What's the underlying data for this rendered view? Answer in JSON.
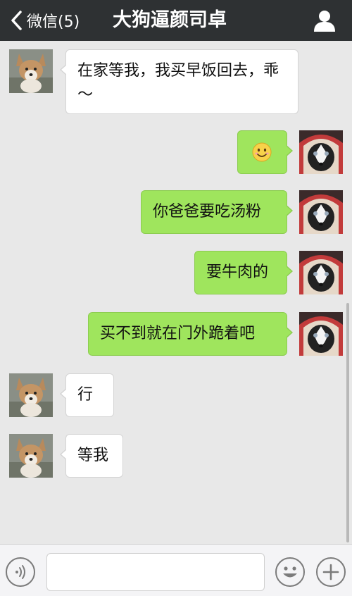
{
  "header": {
    "back_label": "微信(5)",
    "title": "大狗逼颜司卓",
    "profile_icon": "person-icon"
  },
  "messages": [
    {
      "side": "in",
      "text": "在家等我，我买早饭回去，乖～",
      "avatar": "corgi-puppy-avatar"
    },
    {
      "side": "out",
      "text": "",
      "emoji": "smiley-emoji-icon",
      "avatar": "husky-avatar"
    },
    {
      "side": "out",
      "text": "你爸爸要吃汤粉",
      "avatar": "husky-avatar"
    },
    {
      "side": "out",
      "text": "要牛肉的",
      "avatar": "husky-avatar"
    },
    {
      "side": "out",
      "text": "买不到就在门外跪着吧",
      "avatar": "husky-avatar"
    },
    {
      "side": "in",
      "text": "行",
      "avatar": "corgi-puppy-avatar"
    },
    {
      "side": "in",
      "text": "等我",
      "avatar": "corgi-puppy-avatar"
    }
  ],
  "input_bar": {
    "voice_icon": "voice-icon",
    "text_value": "",
    "emoji_icon": "emoji-icon",
    "more_icon": "plus-icon"
  },
  "colors": {
    "header_bg": "#2e3133",
    "chat_bg": "#e8e8e8",
    "incoming_bubble": "#ffffff",
    "outgoing_bubble": "#9fe55d"
  }
}
